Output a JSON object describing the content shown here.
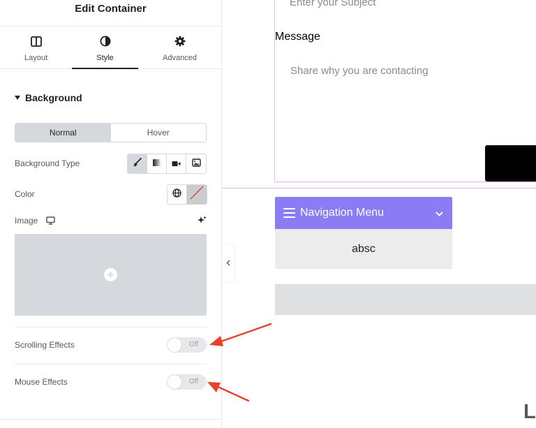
{
  "panel": {
    "title": "Edit Container",
    "tabs": [
      {
        "label": "Layout",
        "icon": "layout-columns-icon"
      },
      {
        "label": "Style",
        "icon": "half-circle-icon",
        "active": true
      },
      {
        "label": "Advanced",
        "icon": "gear-icon"
      }
    ],
    "section": {
      "title": "Background",
      "icon": "caret-down-icon"
    },
    "state_toggle": {
      "normal": "Normal",
      "hover": "Hover",
      "active": "Normal"
    },
    "background_type": {
      "label": "Background Type",
      "options": [
        "brush-icon",
        "gradient-icon",
        "video-camera-icon",
        "slideshow-icon"
      ],
      "selected": "brush-icon"
    },
    "color": {
      "label": "Color",
      "global_icon": "globe-icon",
      "swatch_icon": "no-color-swatch-icon"
    },
    "image": {
      "label": "Image",
      "device_icon": "desktop-icon",
      "ai_icon": "sparkle-icon",
      "add_icon": "plus-circle-icon"
    },
    "scrolling_effects": {
      "label": "Scrolling Effects",
      "value": "Off"
    },
    "mouse_effects": {
      "label": "Mouse Effects",
      "value": "Off"
    },
    "collapse_icon": "chevron-left-icon"
  },
  "canvas": {
    "subject_placeholder": "Enter your Subject",
    "message_label": "Message",
    "message_placeholder": "Share why you are contacting",
    "nav_menu": {
      "title": "Navigation Menu",
      "icon": "hamburger-icon",
      "toggle_icon": "chevron-down-icon"
    },
    "nav_item": "absc",
    "corner_text": "L"
  },
  "colors": {
    "nav_accent": "#8c7cf3",
    "annotation_arrow": "#e8422c",
    "container_outline": "#e8b8ed"
  }
}
